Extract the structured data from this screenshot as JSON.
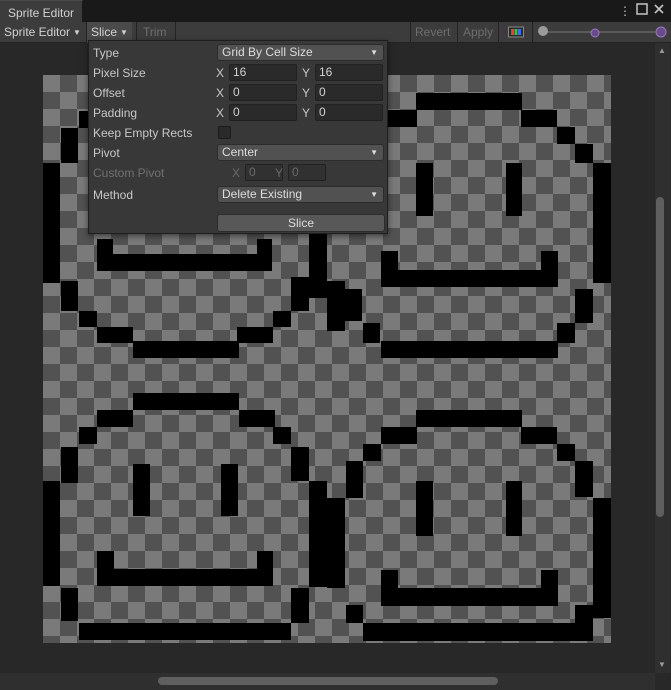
{
  "window": {
    "tab_title": "Sprite Editor"
  },
  "toolbar": {
    "mode_label": "Sprite Editor",
    "slice_label": "Slice",
    "trim_label": "Trim",
    "revert_label": "Revert",
    "apply_label": "Apply"
  },
  "slice_panel": {
    "type_label": "Type",
    "type_value": "Grid By Cell Size",
    "pixel_size_label": "Pixel Size",
    "offset_label": "Offset",
    "padding_label": "Padding",
    "keep_empty_label": "Keep Empty Rects",
    "pivot_label": "Pivot",
    "pivot_value": "Center",
    "custom_pivot_label": "Custom Pivot",
    "method_label": "Method",
    "method_value": "Delete Existing",
    "slice_button": "Slice",
    "x_axis": "X",
    "y_axis": "Y",
    "pixel_size_x": "16",
    "pixel_size_y": "16",
    "offset_x": "0",
    "offset_y": "0",
    "padding_x": "0",
    "padding_y": "0",
    "custom_pivot_x": "0",
    "custom_pivot_y": "0",
    "keep_empty_checked": false
  },
  "colors": {
    "sprite_outline": "#000000",
    "checker_light": "#7a7a7a",
    "checker_dark": "#525252"
  }
}
